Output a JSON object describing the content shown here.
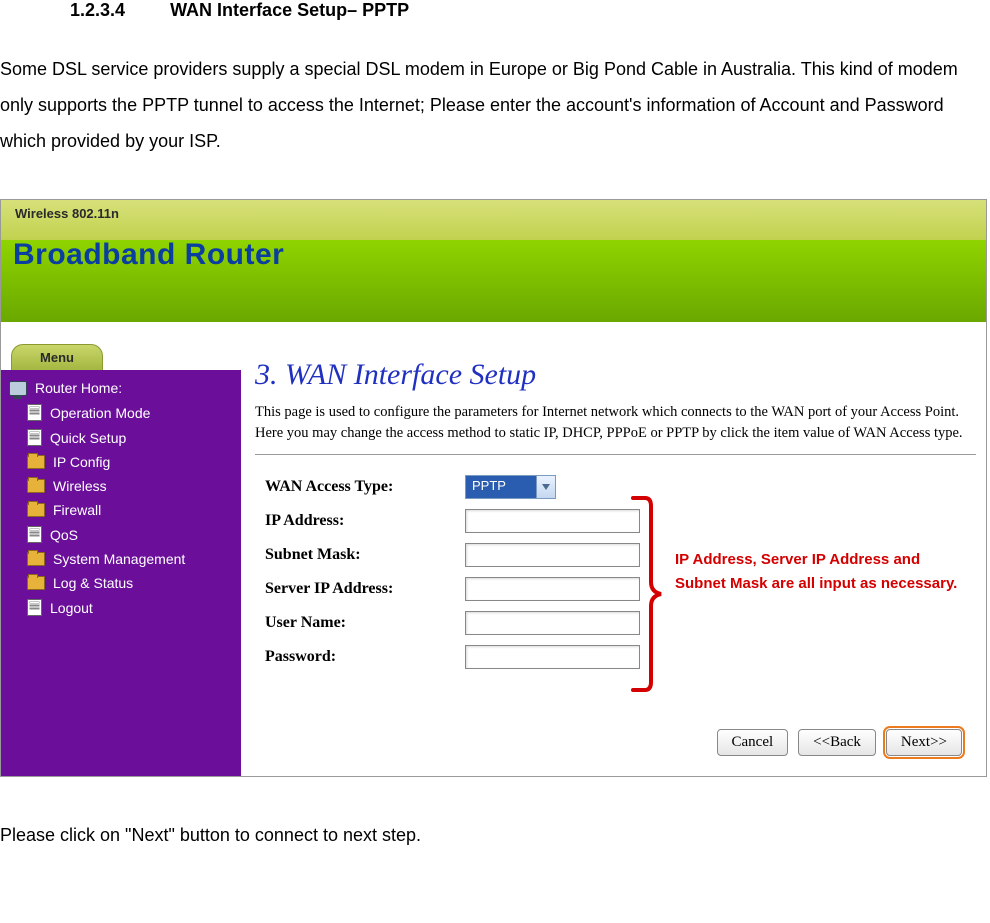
{
  "doc": {
    "heading_number": "1.2.3.4",
    "heading_title": "WAN Interface Setup– PPTP",
    "paragraph": "Some DSL service providers supply a special DSL modem in Europe or Big Pond Cable in Australia. This kind of modem only supports the PPTP tunnel to access the Internet; Please enter the account's information of Account and Password which provided by your ISP.",
    "footer": "Please click on \"Next\" button to connect to next step."
  },
  "router": {
    "product_line": "Wireless 802.11n",
    "product_name": "Broadband Router",
    "menu_tab": "Menu",
    "sidebar": {
      "root": "Router Home:",
      "items": [
        {
          "label": "Operation Mode",
          "icon": "doc"
        },
        {
          "label": "Quick Setup",
          "icon": "doc"
        },
        {
          "label": "IP Config",
          "icon": "folder"
        },
        {
          "label": "Wireless",
          "icon": "folder"
        },
        {
          "label": "Firewall",
          "icon": "folder"
        },
        {
          "label": "QoS",
          "icon": "doc"
        },
        {
          "label": "System Management",
          "icon": "folder"
        },
        {
          "label": "Log & Status",
          "icon": "folder"
        },
        {
          "label": "Logout",
          "icon": "doc"
        }
      ]
    },
    "wizard": {
      "title": "3. WAN Interface Setup",
      "description": "This page is used to configure the parameters for Internet network which connects to the WAN port of your Access Point. Here you may change the access method to static IP, DHCP, PPPoE or PPTP by click the item value of WAN Access type.",
      "fields": {
        "access_type_label": "WAN Access Type:",
        "access_type_value": "PPTP",
        "ip_label": "IP Address:",
        "ip_value": "",
        "subnet_label": "Subnet Mask:",
        "subnet_value": "",
        "server_label": "Server IP Address:",
        "server_value": "",
        "user_label": "User Name:",
        "user_value": "",
        "pass_label": "Password:",
        "pass_value": ""
      },
      "buttons": {
        "cancel": "Cancel",
        "back": "<<Back",
        "next": "Next>>"
      }
    },
    "callout": "IP Address, Server IP Address and Subnet Mask are all input as necessary."
  }
}
